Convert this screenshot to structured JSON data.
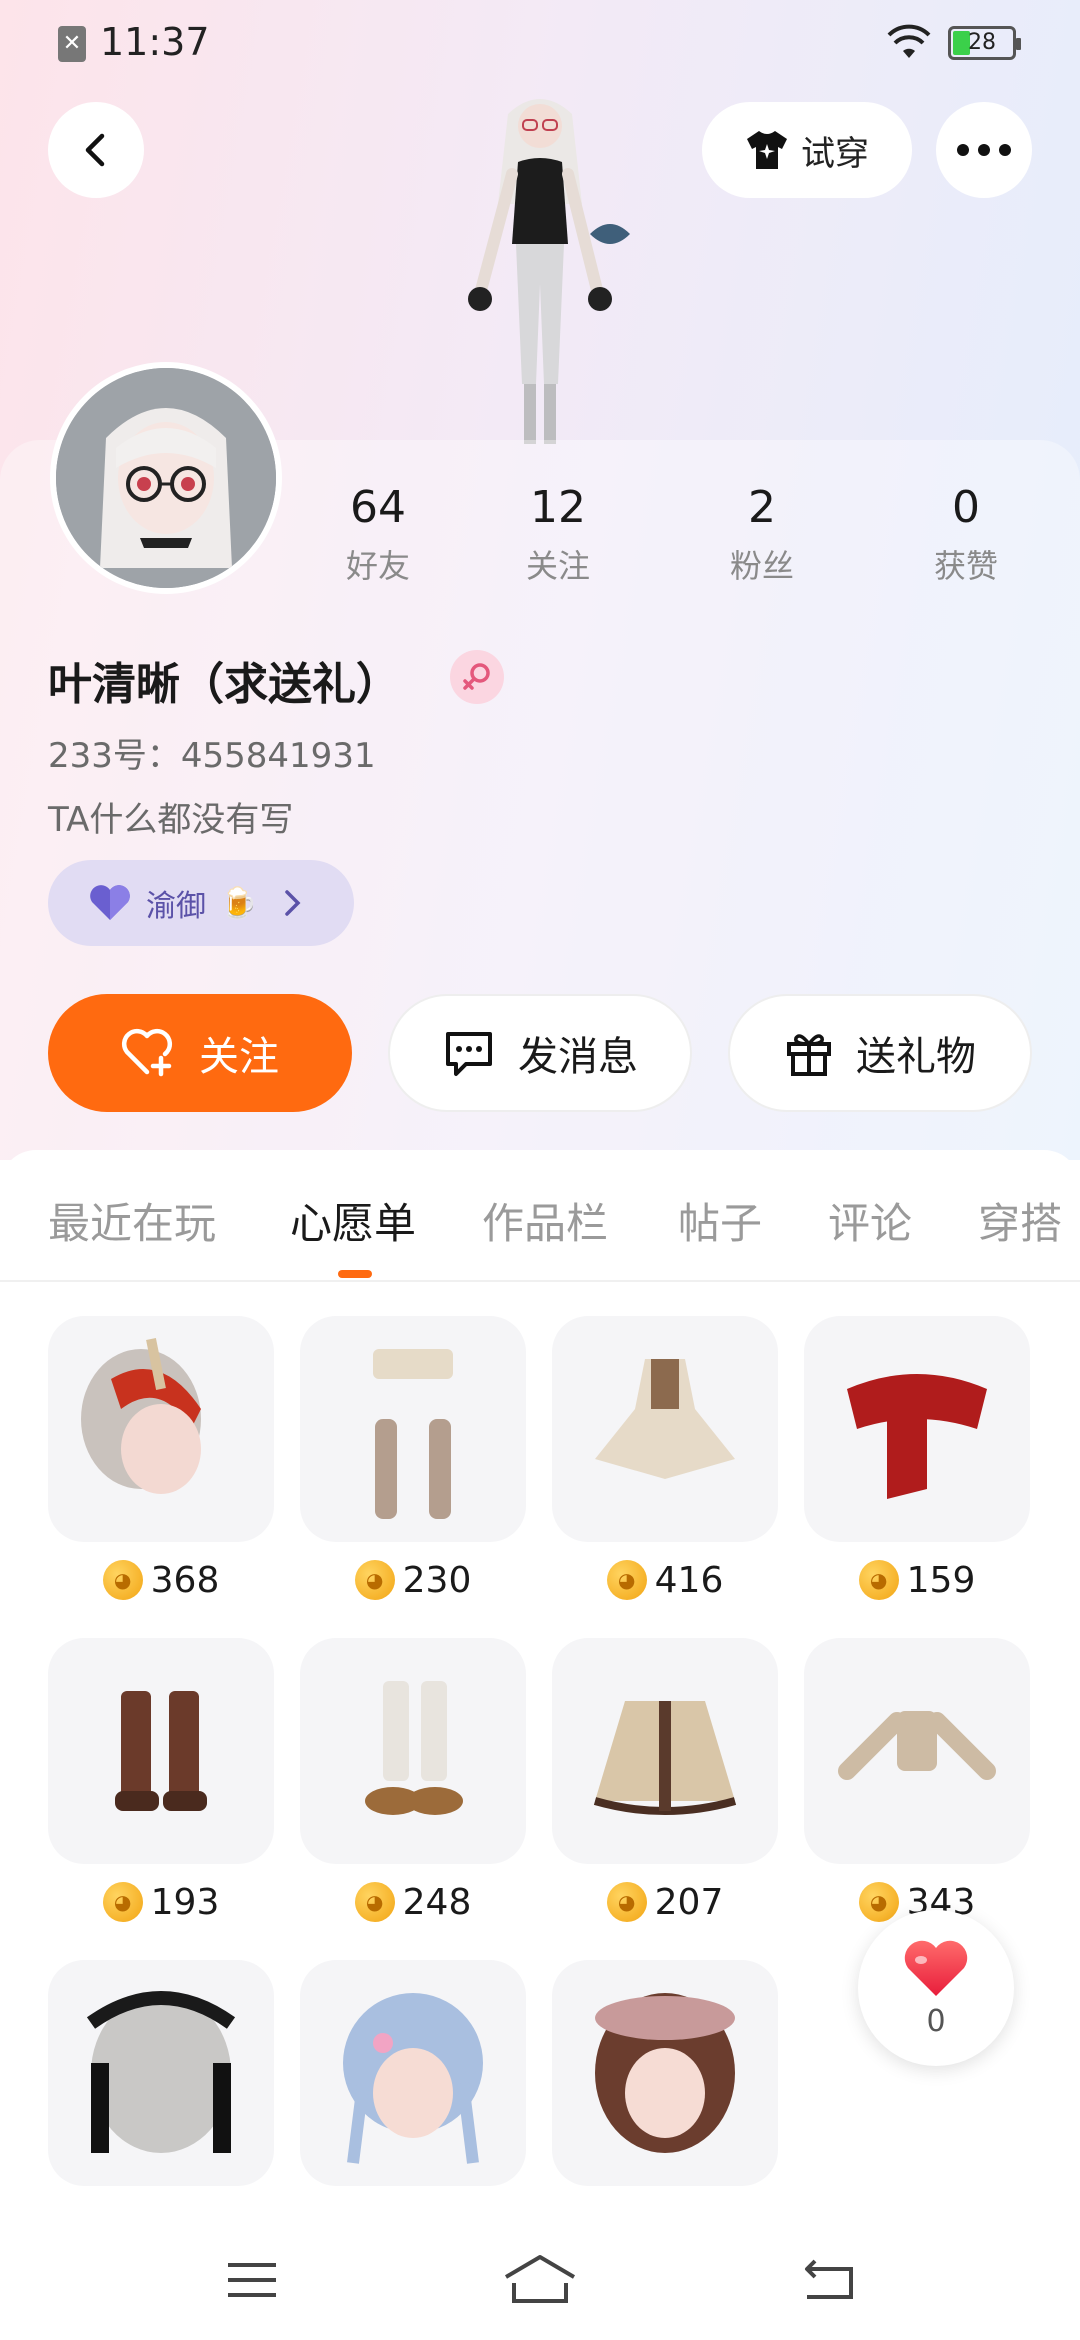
{
  "status_bar": {
    "time": "11:37",
    "battery": "28",
    "battery_level": 0.28
  },
  "header": {
    "try_on_label": "试穿"
  },
  "stats": [
    {
      "value": "64",
      "label": "好友"
    },
    {
      "value": "12",
      "label": "关注"
    },
    {
      "value": "2",
      "label": "粉丝"
    },
    {
      "value": "0",
      "label": "获赞"
    }
  ],
  "profile": {
    "username": "叶清晰（求送礼）",
    "id_text": "233号：455841931",
    "bio": "TA什么都没有写",
    "tag_label": "渝御",
    "tag_emoji": "🍺"
  },
  "actions": {
    "follow_label": "关注",
    "message_label": "发消息",
    "gift_label": "送礼物"
  },
  "tabs": [
    "最近在玩",
    "心愿单",
    "作品栏",
    "帖子",
    "评论",
    "穿搭"
  ],
  "active_tab": "心愿单",
  "wishlist": [
    {
      "price": "368",
      "icon": "hair-icon",
      "color": "#c9c2bd"
    },
    {
      "price": "230",
      "icon": "stockings-icon",
      "color": "#b49e8e"
    },
    {
      "price": "416",
      "icon": "dress-icon",
      "color": "#e6dac8"
    },
    {
      "price": "159",
      "icon": "scarf-icon",
      "color": "#b01c1c"
    },
    {
      "price": "193",
      "icon": "boots-icon",
      "color": "#6b3a2a"
    },
    {
      "price": "248",
      "icon": "shoes-icon",
      "color": "#e8e4de"
    },
    {
      "price": "207",
      "icon": "skirt-icon",
      "color": "#d9c6a8"
    },
    {
      "price": "343",
      "icon": "armor-icon",
      "color": "#cdbba4"
    },
    {
      "price": "",
      "icon": "maid-hair-icon",
      "color": "#c9c8c6"
    },
    {
      "price": "",
      "icon": "blue-hair-icon",
      "color": "#a9bfe0"
    },
    {
      "price": "",
      "icon": "beret-hair-icon",
      "color": "#6b3d2e"
    }
  ],
  "like_float": {
    "count": "0"
  },
  "colors": {
    "accent": "#ff6a10",
    "tag_bg": "#e1dcf3",
    "tag_text": "#5b52a8"
  }
}
